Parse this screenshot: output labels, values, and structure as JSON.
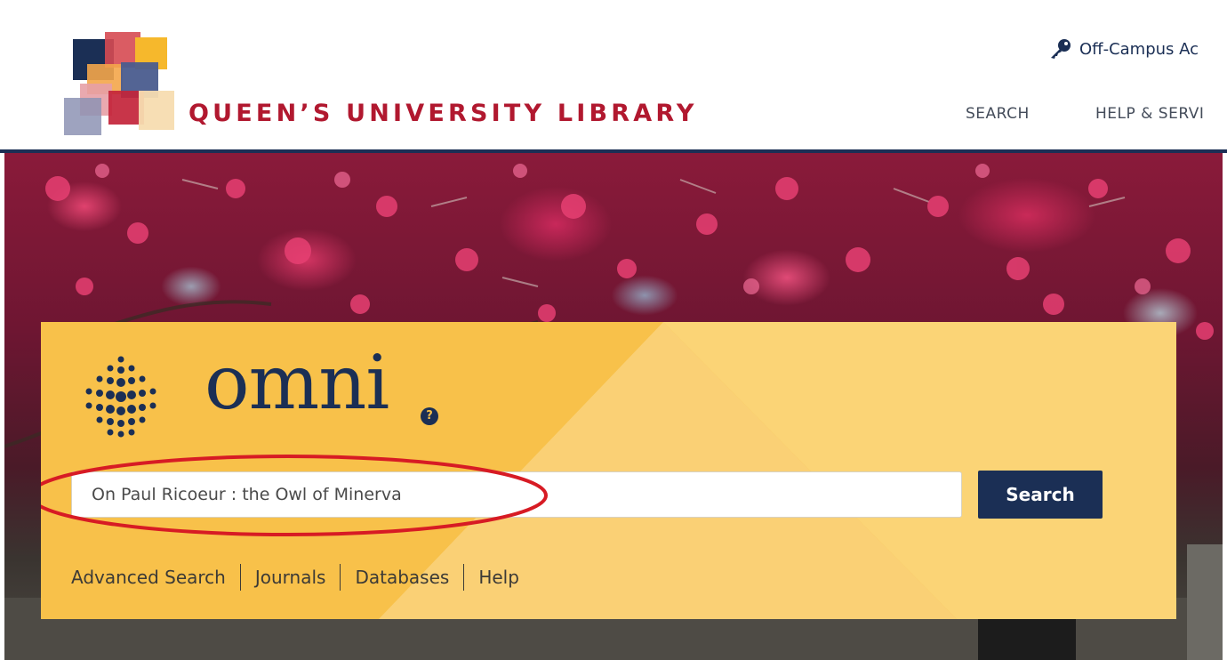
{
  "header": {
    "library_name": "QUEEN’S UNIVERSITY LIBRARY",
    "offcampus_label": "Off-Campus Ac",
    "nav": {
      "search": "SEARCH",
      "help": "HELP & SERVI"
    },
    "icons": {
      "offcampus": "key-icon"
    },
    "colors": {
      "brand_red": "#b1182f",
      "navy": "#1b2f55"
    }
  },
  "omni": {
    "logo_word": "omni",
    "help_glyph": "?",
    "search": {
      "value": "On Paul Ricoeur : the Owl of Minerva",
      "button_label": "Search"
    },
    "links": [
      "Advanced Search",
      "Journals",
      "Databases",
      "Help"
    ],
    "colors": {
      "panel": "#f8c14a",
      "button": "#1b2f55",
      "highlight": "#d71b24"
    }
  }
}
